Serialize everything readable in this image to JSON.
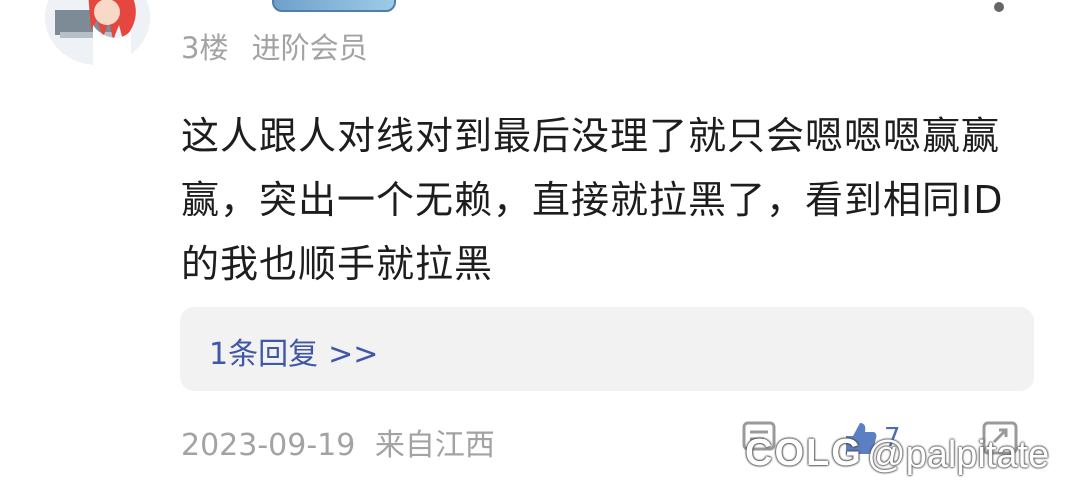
{
  "post": {
    "username": "",
    "floor": "3楼",
    "member_level": "进阶会员",
    "content": "这人跟人对线对到最后没理了就只会嗯嗯嗯赢赢赢，突出一个无赖，直接就拉黑了，看到相同ID的我也顺手就拉黑",
    "replies_link": "1条回复",
    "replies_arrows": ">>",
    "date": "2023-09-19",
    "location": "来自江西",
    "like_count": "7"
  },
  "icons": {
    "avatar": "avatar-icon",
    "more": "more-icon",
    "comment": "comment-icon",
    "like": "like-icon",
    "share": "share-icon"
  },
  "watermark": {
    "logo": "COLG",
    "handle": "@palpitate"
  },
  "colors": {
    "link": "#3f57a6",
    "meta": "#a3a3a3",
    "reply_bg": "#f2f2f2",
    "like_accent": "#4a6fb0"
  }
}
